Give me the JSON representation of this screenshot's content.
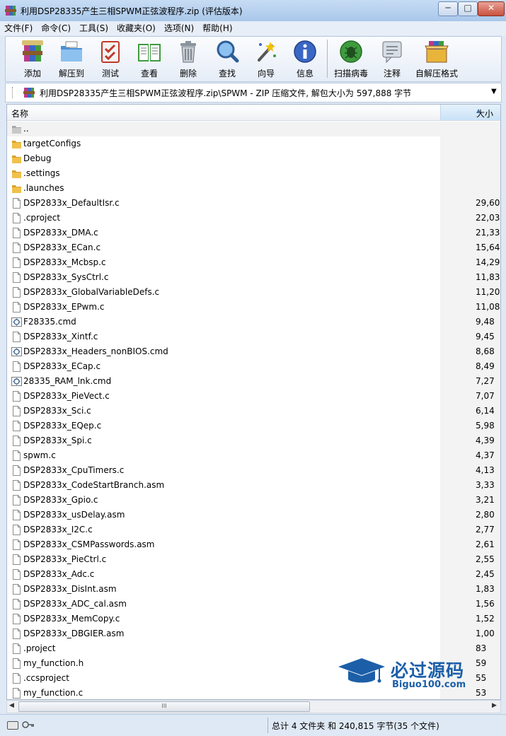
{
  "window": {
    "title": "利用DSP28335产生三相SPWM正弦波程序.zip (评估版本)",
    "min_label": "─",
    "max_label": "□",
    "close_label": "✕"
  },
  "menu": [
    "文件(F)",
    "命令(C)",
    "工具(S)",
    "收藏夹(O)",
    "选项(N)",
    "帮助(H)"
  ],
  "toolbar": [
    {
      "label": "添加",
      "icon": "add-archive-icon"
    },
    {
      "label": "解压到",
      "icon": "extract-to-icon"
    },
    {
      "label": "测试",
      "icon": "test-icon"
    },
    {
      "label": "查看",
      "icon": "view-book-icon"
    },
    {
      "label": "删除",
      "icon": "delete-trash-icon"
    },
    {
      "label": "查找",
      "icon": "find-magnifier-icon"
    },
    {
      "label": "向导",
      "icon": "wizard-wand-icon"
    },
    {
      "label": "信息",
      "icon": "info-icon"
    },
    {
      "label": "扫描病毒",
      "icon": "virus-scan-icon"
    },
    {
      "label": "注释",
      "icon": "comment-icon"
    },
    {
      "label": "自解压格式",
      "icon": "sfx-box-icon"
    }
  ],
  "address": {
    "path": "利用DSP28335产生三相SPWM正弦波程序.zip\\SPWM - ZIP 压缩文件, 解包大小为 597,888 字节",
    "dropdown": "▼"
  },
  "columns": {
    "name": "名称",
    "size": "大小",
    "sort_arrow": "▲"
  },
  "files": [
    {
      "name": "..",
      "size": "",
      "type": "up"
    },
    {
      "name": "targetConfigs",
      "size": "",
      "type": "folder"
    },
    {
      "name": "Debug",
      "size": "",
      "type": "folder"
    },
    {
      "name": ".settings",
      "size": "",
      "type": "folder"
    },
    {
      "name": ".launches",
      "size": "",
      "type": "folder"
    },
    {
      "name": "DSP2833x_DefaultIsr.c",
      "size": "29,60",
      "type": "file"
    },
    {
      "name": ".cproject",
      "size": "22,03",
      "type": "file"
    },
    {
      "name": "DSP2833x_DMA.c",
      "size": "21,33",
      "type": "file"
    },
    {
      "name": "DSP2833x_ECan.c",
      "size": "15,64",
      "type": "file"
    },
    {
      "name": "DSP2833x_Mcbsp.c",
      "size": "14,29",
      "type": "file"
    },
    {
      "name": "DSP2833x_SysCtrl.c",
      "size": "11,83",
      "type": "file"
    },
    {
      "name": "DSP2833x_GlobalVariableDefs.c",
      "size": "11,20",
      "type": "file"
    },
    {
      "name": "DSP2833x_EPwm.c",
      "size": "11,08",
      "type": "file"
    },
    {
      "name": "F28335.cmd",
      "size": "9,48",
      "type": "cmd"
    },
    {
      "name": "DSP2833x_Xintf.c",
      "size": "9,45",
      "type": "file"
    },
    {
      "name": "DSP2833x_Headers_nonBIOS.cmd",
      "size": "8,68",
      "type": "cmd"
    },
    {
      "name": "DSP2833x_ECap.c",
      "size": "8,49",
      "type": "file"
    },
    {
      "name": "28335_RAM_lnk.cmd",
      "size": "7,27",
      "type": "cmd"
    },
    {
      "name": "DSP2833x_PieVect.c",
      "size": "7,07",
      "type": "file"
    },
    {
      "name": "DSP2833x_Sci.c",
      "size": "6,14",
      "type": "file"
    },
    {
      "name": "DSP2833x_EQep.c",
      "size": "5,98",
      "type": "file"
    },
    {
      "name": "DSP2833x_Spi.c",
      "size": "4,39",
      "type": "file"
    },
    {
      "name": "spwm.c",
      "size": "4,37",
      "type": "file"
    },
    {
      "name": "DSP2833x_CpuTimers.c",
      "size": "4,13",
      "type": "file"
    },
    {
      "name": "DSP2833x_CodeStartBranch.asm",
      "size": "3,33",
      "type": "file"
    },
    {
      "name": "DSP2833x_Gpio.c",
      "size": "3,21",
      "type": "file"
    },
    {
      "name": "DSP2833x_usDelay.asm",
      "size": "2,80",
      "type": "file"
    },
    {
      "name": "DSP2833x_I2C.c",
      "size": "2,77",
      "type": "file"
    },
    {
      "name": "DSP2833x_CSMPasswords.asm",
      "size": "2,61",
      "type": "file"
    },
    {
      "name": "DSP2833x_PieCtrl.c",
      "size": "2,55",
      "type": "file"
    },
    {
      "name": "DSP2833x_Adc.c",
      "size": "2,45",
      "type": "file"
    },
    {
      "name": "DSP2833x_DisInt.asm",
      "size": "1,83",
      "type": "file"
    },
    {
      "name": "DSP2833x_ADC_cal.asm",
      "size": "1,56",
      "type": "file"
    },
    {
      "name": "DSP2833x_MemCopy.c",
      "size": "1,52",
      "type": "file"
    },
    {
      "name": "DSP2833x_DBGIER.asm",
      "size": "1,00",
      "type": "file"
    },
    {
      "name": ".project",
      "size": "83",
      "type": "file"
    },
    {
      "name": "my_function.h",
      "size": "59",
      "type": "file"
    },
    {
      "name": ".ccsproject",
      "size": "55",
      "type": "file"
    },
    {
      "name": "my_function.c",
      "size": "53",
      "type": "file"
    }
  ],
  "scrollbar": {
    "left": "◀",
    "right": "▶",
    "grip": "III"
  },
  "status": {
    "text": "总计 4 文件夹 和 240,815 字节(35 个文件)"
  },
  "watermark": {
    "cn": "必过源码",
    "en": "Biguo100.com"
  },
  "colors": {
    "accent": "#1c5fa8",
    "folder": "#e8b43a",
    "titlebar": "#b6d0ee"
  }
}
